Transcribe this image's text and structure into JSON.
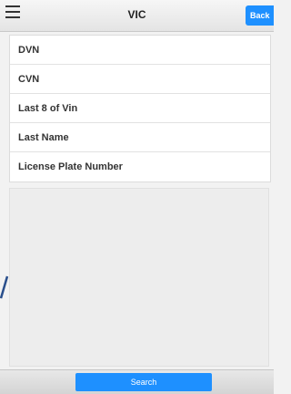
{
  "header": {
    "title": "VIC",
    "back_label": "Back"
  },
  "list": {
    "items": [
      {
        "label": "DVN"
      },
      {
        "label": "CVN"
      },
      {
        "label": "Last 8 of Vin"
      },
      {
        "label": "Last Name"
      },
      {
        "label": "License Plate Number"
      }
    ]
  },
  "footer": {
    "search_label": "Search"
  },
  "colors": {
    "accent": "#1e90ff",
    "background": "#f2f2f2"
  }
}
